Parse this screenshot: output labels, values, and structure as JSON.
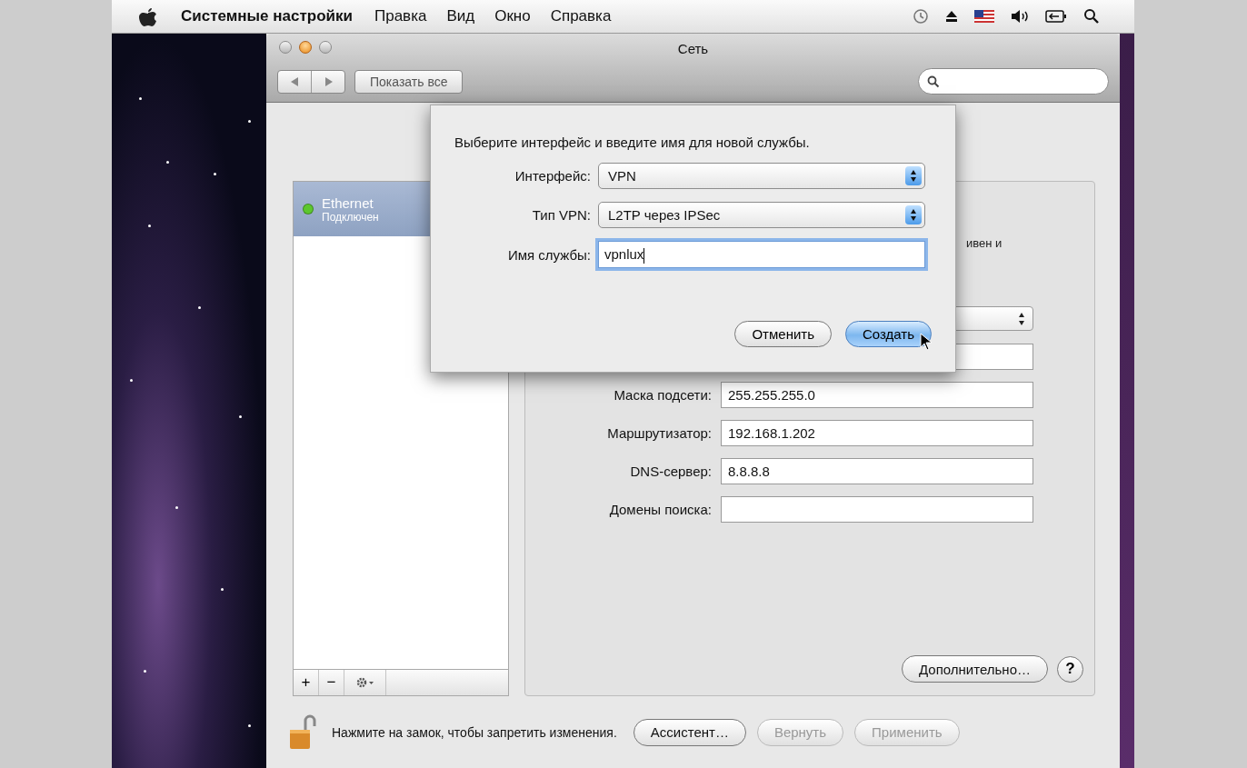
{
  "menu_bar": {
    "app_name": "Системные настройки",
    "items": [
      "Правка",
      "Вид",
      "Окно",
      "Справка"
    ]
  },
  "window": {
    "title": "Сеть",
    "show_all_button": "Показать все"
  },
  "services": [
    {
      "name": "Ethernet",
      "status": "Подключен",
      "color": "#5cc72e",
      "selected": true
    }
  ],
  "list_buttons": [
    "+",
    "−"
  ],
  "details": {
    "status_fragment": "ивен и",
    "fields": [
      {
        "label": "Маска подсети:",
        "value": "255.255.255.0"
      },
      {
        "label": "Маршрутизатор:",
        "value": "192.168.1.202"
      },
      {
        "label": "DNS-сервер:",
        "value": "8.8.8.8"
      },
      {
        "label": "Домены поиска:"
      }
    ],
    "advanced_button": "Дополнительно…",
    "help_button": "?"
  },
  "footer": {
    "lock_text": "Нажмите на замок, чтобы запретить изменения.",
    "buttons": [
      {
        "label": "Ассистент…",
        "disabled": false
      },
      {
        "label": "Вернуть",
        "disabled": true
      },
      {
        "label": "Применить",
        "disabled": true
      }
    ]
  },
  "sheet": {
    "prompt": "Выберите интерфейс и введите имя для новой службы.",
    "rows": [
      {
        "kind": "popup",
        "label": "Интерфейс:",
        "value": "VPN"
      },
      {
        "kind": "popup",
        "label": "Тип VPN:",
        "value": "L2TP через IPSec"
      },
      {
        "kind": "text",
        "label": "Имя службы:",
        "value": "vpnlux",
        "focused": true
      }
    ],
    "buttons": [
      {
        "label": "Отменить",
        "default": false
      },
      {
        "label": "Создать",
        "default": true
      }
    ]
  }
}
